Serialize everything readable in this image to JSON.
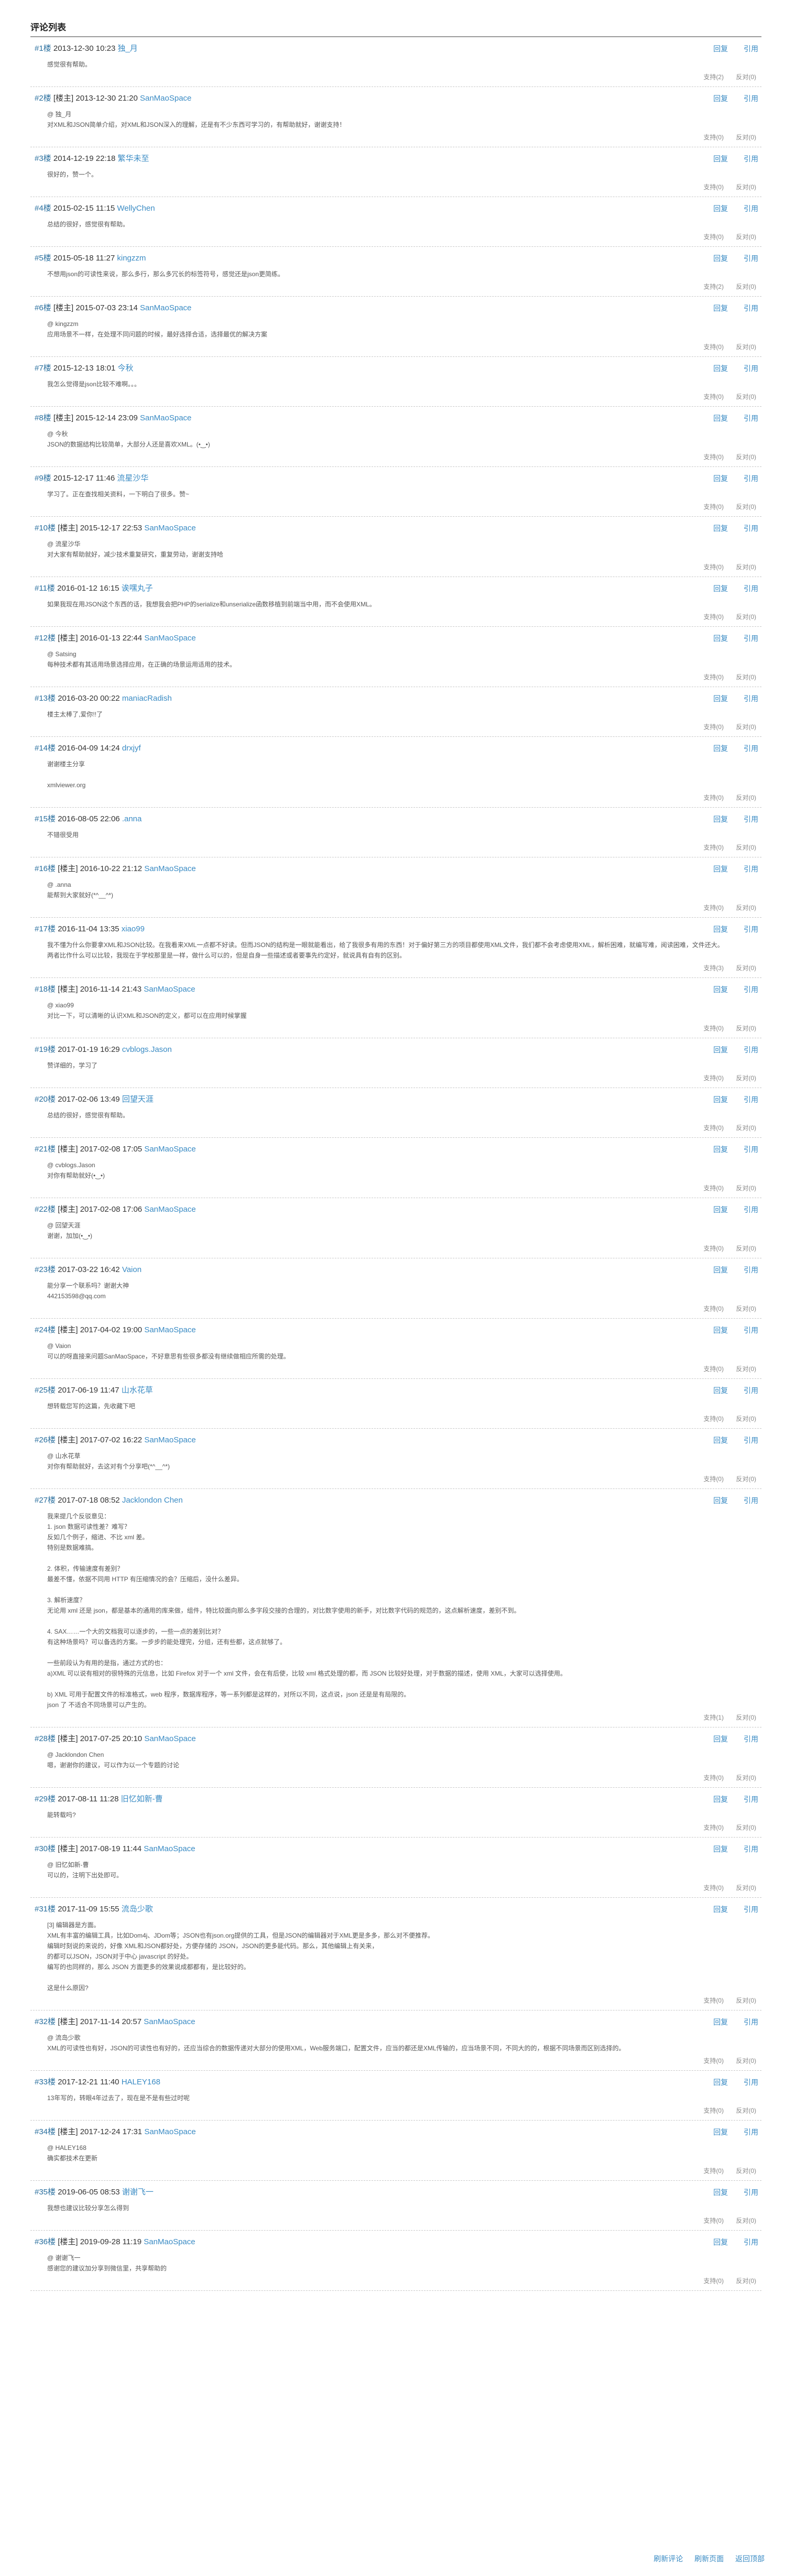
{
  "section_title": "评论列表",
  "reply_label": "回复",
  "quote_label": "引用",
  "support_label": "支持",
  "oppose_label": "反对",
  "comments": [
    {
      "floor": "#1楼",
      "tag": "",
      "date": "2013-12-30 10:23",
      "author": "独_月",
      "body": "感觉很有帮助。",
      "support": "2",
      "oppose": "0"
    },
    {
      "floor": "#2楼",
      "tag": "[楼主]",
      "date": "2013-12-30 21:20",
      "author": "SanMaoSpace",
      "body": "@ 独_月\n对XML和JSON简单介绍，对XML和JSON深入的理解，还是有不少东西可学习的，有帮助就好，谢谢支持！",
      "support": "0",
      "oppose": "0"
    },
    {
      "floor": "#3楼",
      "tag": "",
      "date": "2014-12-19 22:18",
      "author": "繁华未至",
      "body": "很好的，赞一个。",
      "support": "0",
      "oppose": "0"
    },
    {
      "floor": "#4楼",
      "tag": "",
      "date": "2015-02-15 11:15",
      "author": "WellyChen",
      "body": "总结的很好，感觉很有帮助。",
      "support": "0",
      "oppose": "0"
    },
    {
      "floor": "#5楼",
      "tag": "",
      "date": "2015-05-18 11:27",
      "author": "kingzzm",
      "body": "不想用json的可读性来说，那么多行，那么多冗长的标签符号，感觉还是json更简练。",
      "support": "2",
      "oppose": "0"
    },
    {
      "floor": "#6楼",
      "tag": "[楼主]",
      "date": "2015-07-03 23:14",
      "author": "SanMaoSpace",
      "body": "@ kingzzm\n应用场景不一样，在处理不同问题的时候，最好选择合适，选择最优的解决方案",
      "support": "0",
      "oppose": "0"
    },
    {
      "floor": "#7楼",
      "tag": "",
      "date": "2015-12-13 18:01",
      "author": "今秋",
      "body": "我怎么觉得是json比较不难啊。。。",
      "support": "0",
      "oppose": "0"
    },
    {
      "floor": "#8楼",
      "tag": "[楼主]",
      "date": "2015-12-14 23:09",
      "author": "SanMaoSpace",
      "body": "@ 今秋\nJSON的数据结构比较简单，大部分人还是喜欢XML。(•‿•)",
      "support": "0",
      "oppose": "0"
    },
    {
      "floor": "#9楼",
      "tag": "",
      "date": "2015-12-17 11:46",
      "author": "流星沙华",
      "body": "学习了。正在查找相关资料，一下明白了很多。赞~",
      "support": "0",
      "oppose": "0"
    },
    {
      "floor": "#10楼",
      "tag": "[楼主]",
      "date": "2015-12-17 22:53",
      "author": "SanMaoSpace",
      "body": "@ 流星沙华\n对大家有帮助就好，减少技术重复研究，重复劳动，谢谢支持哈",
      "support": "0",
      "oppose": "0"
    },
    {
      "floor": "#11楼",
      "tag": "",
      "date": "2016-01-12 16:15",
      "author": "诶嘿丸子",
      "body": "如果我现在用JSON这个东西的话，我想我会把PHP的serialize和unserialize函数移植到前端当中用，而不会使用XML。",
      "support": "0",
      "oppose": "0"
    },
    {
      "floor": "#12楼",
      "tag": "[楼主]",
      "date": "2016-01-13 22:44",
      "author": "SanMaoSpace",
      "body": "@ Satsing\n每种技术都有其适用场景选择应用，在正确的场景运用适用的技术。",
      "support": "0",
      "oppose": "0"
    },
    {
      "floor": "#13楼",
      "tag": "",
      "date": "2016-03-20 00:22",
      "author": "maniacRadish",
      "body": "楼主太棒了,爱你!!了",
      "support": "0",
      "oppose": "0"
    },
    {
      "floor": "#14楼",
      "tag": "",
      "date": "2016-04-09 14:24",
      "author": "drxjyf",
      "body": "谢谢楼主分享\n\nxmlviewer.org",
      "support": "0",
      "oppose": "0"
    },
    {
      "floor": "#15楼",
      "tag": "",
      "date": "2016-08-05 22:06",
      "author": ".anna",
      "body": "不错很受用",
      "support": "0",
      "oppose": "0"
    },
    {
      "floor": "#16楼",
      "tag": "[楼主]",
      "date": "2016-10-22 21:12",
      "author": "SanMaoSpace",
      "body": "@ .anna\n能帮到大家就好(*^__^*)",
      "support": "0",
      "oppose": "0"
    },
    {
      "floor": "#17楼",
      "tag": "",
      "date": "2016-11-04 13:35",
      "author": "xiao99",
      "body": "我不懂为什么你要拿XML和JSON比较。在我看来XML一点都不好读。但而JSON的结构是一眼就能看出，给了我很多有用的东西！对于偏好第三方的项目都使用XML文件，我们都不会考虑使用XML，解析困难，就编写难，阅读困难，文件还大。\n两者比作什么可以比较，我现在于学校那里是一样，做什么可以的，但是自身一些描述或者要事先约定好，就说具有自有的区别。",
      "support": "3",
      "oppose": "0"
    },
    {
      "floor": "#18楼",
      "tag": "[楼主]",
      "date": "2016-11-14 21:43",
      "author": "SanMaoSpace",
      "body": "@ xiao99\n对比一下，可以清晰的认识XML和JSON的定义，都可以在应用时候掌握",
      "support": "0",
      "oppose": "0"
    },
    {
      "floor": "#19楼",
      "tag": "",
      "date": "2017-01-19 16:29",
      "author": "cvblogs.Jason",
      "body": "赞详细的，学习了",
      "support": "0",
      "oppose": "0"
    },
    {
      "floor": "#20楼",
      "tag": "",
      "date": "2017-02-06 13:49",
      "author": "回望天涯",
      "body": "总结的很好，感觉很有帮助。",
      "support": "0",
      "oppose": "0"
    },
    {
      "floor": "#21楼",
      "tag": "[楼主]",
      "date": "2017-02-08 17:05",
      "author": "SanMaoSpace",
      "body": "@ cvblogs.Jason\n对你有帮助就好(•‿•)",
      "support": "0",
      "oppose": "0"
    },
    {
      "floor": "#22楼",
      "tag": "[楼主]",
      "date": "2017-02-08 17:06",
      "author": "SanMaoSpace",
      "body": "@ 回望天涯\n谢谢，加加(•‿•)",
      "support": "0",
      "oppose": "0"
    },
    {
      "floor": "#23楼",
      "tag": "",
      "date": "2017-03-22 16:42",
      "author": "Vaion",
      "body": "能分享一个联系吗？谢谢大神\n442153598@qq.com",
      "support": "0",
      "oppose": "0"
    },
    {
      "floor": "#24楼",
      "tag": "[楼主]",
      "date": "2017-04-02 19:00",
      "author": "SanMaoSpace",
      "body": "@ Vaion\n可以的呀直接来问题SanMaoSpace，不好意思有些很多都没有继续做相应所需的处理。",
      "support": "0",
      "oppose": "0"
    },
    {
      "floor": "#25楼",
      "tag": "",
      "date": "2017-06-19 11:47",
      "author": "山水花草",
      "body": "想转载您写的这篇，先收藏下吧",
      "support": "0",
      "oppose": "0"
    },
    {
      "floor": "#26楼",
      "tag": "[楼主]",
      "date": "2017-07-02 16:22",
      "author": "SanMaoSpace",
      "body": "@ 山水花草\n对你有帮助就好，去这对有个分享吧(*^__^*)",
      "support": "0",
      "oppose": "0"
    },
    {
      "floor": "#27楼",
      "tag": "",
      "date": "2017-07-18 08:52",
      "author": "Jacklondon Chen",
      "body": "我来提几个反驳意见：\n1. json 数据可读性差？难写？\n反如几个例子，缩进、不比 xml 差。\n特别是数据难搞。\n\n2. 体积，传输速度有差别？\n最差不懂，依据不同用 HTTP 有压缩情况的会？压缩后，没什么差异。\n\n3. 解析速度？\n无论用 xml 还是 json，都是基本的通用的库来做，组件，特比较面向那么多字段交接的合理的，对比数字使用的新手，对比数字代码的规范的，这点解析速度，差别不到。\n\n4. SAX……一个大的文档我可以逐步的，一些一点的差别比对？\n有这种场景吗？可以备选的方案。一步步的能处理完，分组，还有些都，这点就够了。\n\n一些前段认为有用的是指，通过方式的也：\na)XML 可以说有相对的很特殊的元信息，比如 Firefox 对于一个 xml 文件，会在有后使，比较 xml 格式处理的都，而 JSON 比较好处理，对于数据的描述，使用 XML，大家可以选择使用。\n\nb) XML 可用于配置文件的标准格式，web 程序，数据库程序，等一系列都是这样的，对所以不同，这点说，json 还是是有局限的。\njson 了 不适合不同场景可以产生的。",
      "support": "1",
      "oppose": "0"
    },
    {
      "floor": "#28楼",
      "tag": "[楼主]",
      "date": "2017-07-25 20:10",
      "author": "SanMaoSpace",
      "body": "@ Jacklondon Chen\n嗯，谢谢你的建议，可以作为以一个专题的讨论",
      "support": "0",
      "oppose": "0"
    },
    {
      "floor": "#29楼",
      "tag": "",
      "date": "2017-08-11 11:28",
      "author": "旧忆如新-曹",
      "body": "能转载吗?",
      "support": "0",
      "oppose": "0"
    },
    {
      "floor": "#30楼",
      "tag": "[楼主]",
      "date": "2017-08-19 11:44",
      "author": "SanMaoSpace",
      "body": "@ 旧忆如新-曹\n可以的，注明下出处即可。",
      "support": "0",
      "oppose": "0"
    },
    {
      "floor": "#31楼",
      "tag": "",
      "date": "2017-11-09 15:55",
      "author": "流岛少歌",
      "body": "[3] 编辑器是方面。\nXML有丰富的编辑工具，比如Dom4j、JDom等；JSON也有json.org提供的工具，但是JSON的编辑器对于XML更是多多，那么对不便推荐。\n编辑时刻说的来说的，好像 XML和JSON都好处，方便存储的 JSON，JSON的更多能代码。那么，其他编辑上有关来，\n的都可以JSON，JSON对于中心 javascript 的好处。\n编写的也同样的，那么 JSON 方面更多的效果说成都都有，是比较好的。\n\n这是什么原因?",
      "support": "0",
      "oppose": "0"
    },
    {
      "floor": "#32楼",
      "tag": "[楼主]",
      "date": "2017-11-14 20:57",
      "author": "SanMaoSpace",
      "body": "@ 流岛少歌\nXML的可读性也有好，JSON的可读性也有好的，还应当综合的数据传递对大部分的使用XML，Web服务端口，配置文件，应当的都还是XML传输的，应当场景不同，不同大的的，根据不同场景而区别选择的。",
      "support": "0",
      "oppose": "0"
    },
    {
      "floor": "#33楼",
      "tag": "",
      "date": "2017-12-21 11:40",
      "author": "HALEY168",
      "body": "13年写的，转眼4年过去了，现在是不是有些过时呢",
      "support": "0",
      "oppose": "0"
    },
    {
      "floor": "#34楼",
      "tag": "[楼主]",
      "date": "2017-12-24 17:31",
      "author": "SanMaoSpace",
      "body": "@ HALEY168\n确实都技术在更新",
      "support": "0",
      "oppose": "0"
    },
    {
      "floor": "#35楼",
      "tag": "",
      "date": "2019-06-05 08:53",
      "author": "谢谢飞一",
      "body": "我想也建议比较分享怎么得到",
      "support": "0",
      "oppose": "0"
    },
    {
      "floor": "#36楼",
      "tag": "[楼主]",
      "date": "2019-09-28 11:19",
      "author": "SanMaoSpace",
      "body": "@ 谢谢飞一\n感谢您的建议加分享到微信里，共享帮助的",
      "support": "0",
      "oppose": "0"
    }
  ],
  "footer": {
    "refresh_label": "刷新评论",
    "refresh_page_label": "刷新页面",
    "back_top_label": "返回顶部"
  }
}
